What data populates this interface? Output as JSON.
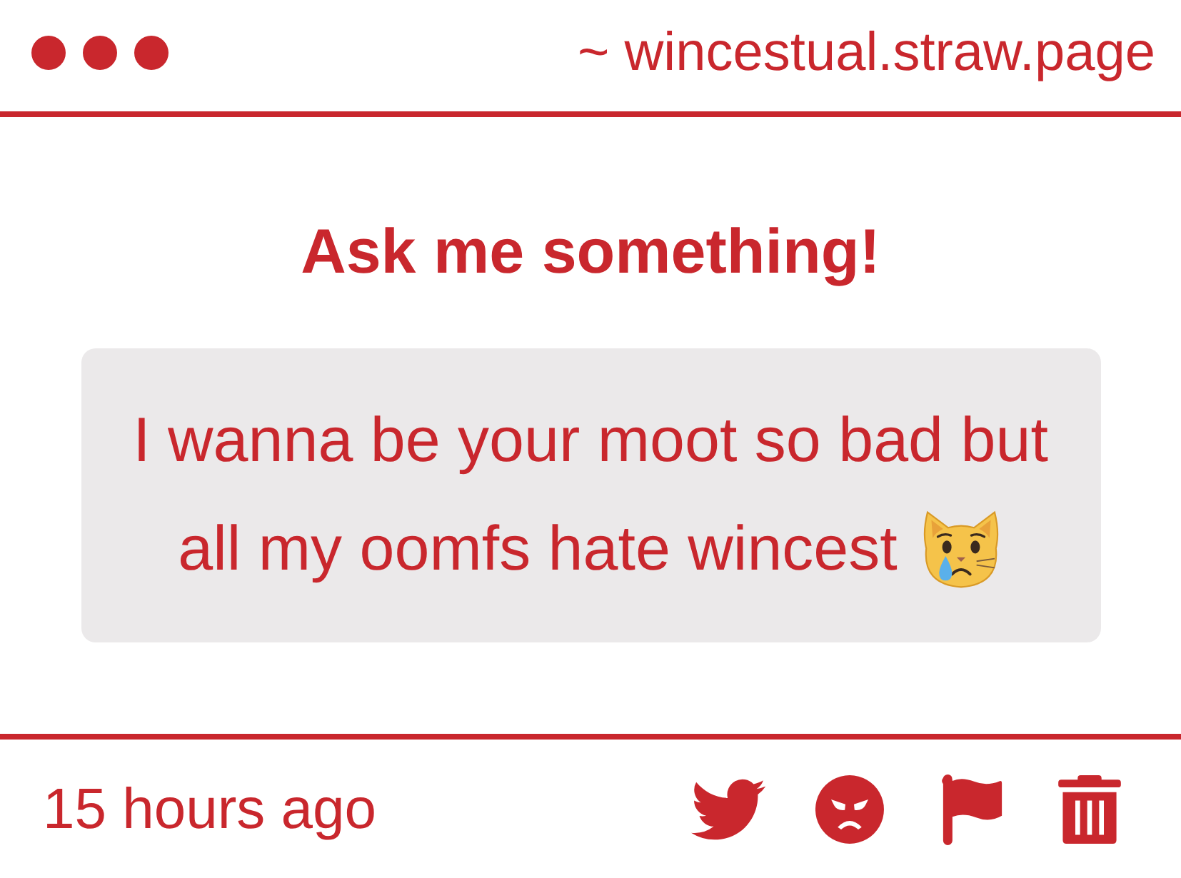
{
  "header": {
    "site": "~ wincestual.straw.page"
  },
  "title": "Ask me something!",
  "question": {
    "lines": [
      "I wanna be your moot so bad but",
      "all my oomfs hate wincest"
    ]
  },
  "footer": {
    "time": "15 hours ago"
  }
}
